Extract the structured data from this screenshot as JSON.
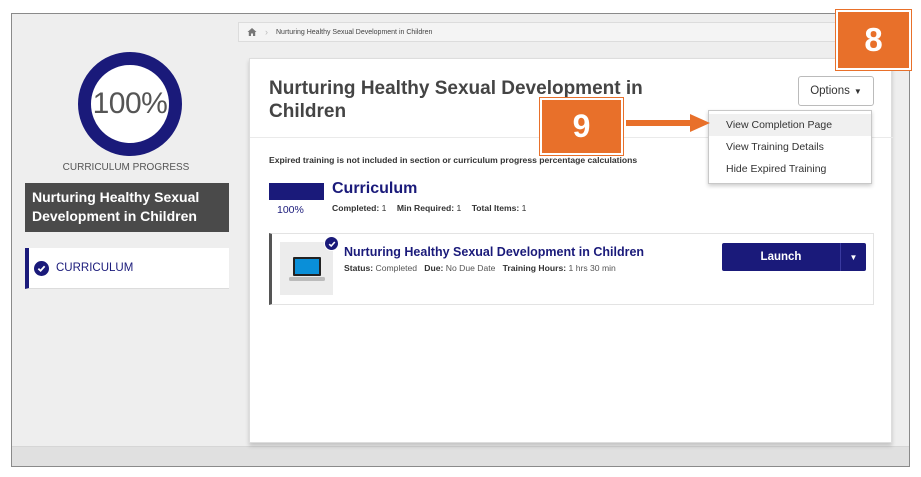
{
  "breadcrumb": {
    "home_icon": "home-icon",
    "current": "Nurturing Healthy Sexual Development in Children"
  },
  "sidebar": {
    "progress_percent": "100%",
    "progress_value": 1.0,
    "progress_label": "CURRICULUM PROGRESS",
    "course_title": "Nurturing Healthy Sexual Development in Children",
    "section_label": "CURRICULUM"
  },
  "main": {
    "title": "Nurturing Healthy Sexual Development in Children",
    "options_label": "Options",
    "expired_note": "Expired training is not included in section or curriculum progress percentage calculations",
    "curriculum": {
      "title": "Curriculum",
      "percent": "100%",
      "completed_label": "Completed:",
      "completed_value": "1",
      "min_required_label": "Min Required:",
      "min_required_value": "1",
      "total_items_label": "Total Items:",
      "total_items_value": "1"
    },
    "training": {
      "title": "Nurturing Healthy Sexual Development in Children",
      "status_label": "Status:",
      "status_value": "Completed",
      "due_label": "Due:",
      "due_value": "No Due Date",
      "hours_label": "Training Hours:",
      "hours_value": "1 hrs 30 min",
      "launch_label": "Launch"
    }
  },
  "options_menu": {
    "items": [
      {
        "label": "View Completion Page"
      },
      {
        "label": "View Training Details"
      },
      {
        "label": "Hide Expired Training"
      }
    ]
  },
  "annotations": {
    "step_8": "8",
    "step_9": "9"
  },
  "colors": {
    "accent": "#1a1a7a",
    "annotation": "#e8702a",
    "sidebar_header": "#4a4a4a"
  }
}
